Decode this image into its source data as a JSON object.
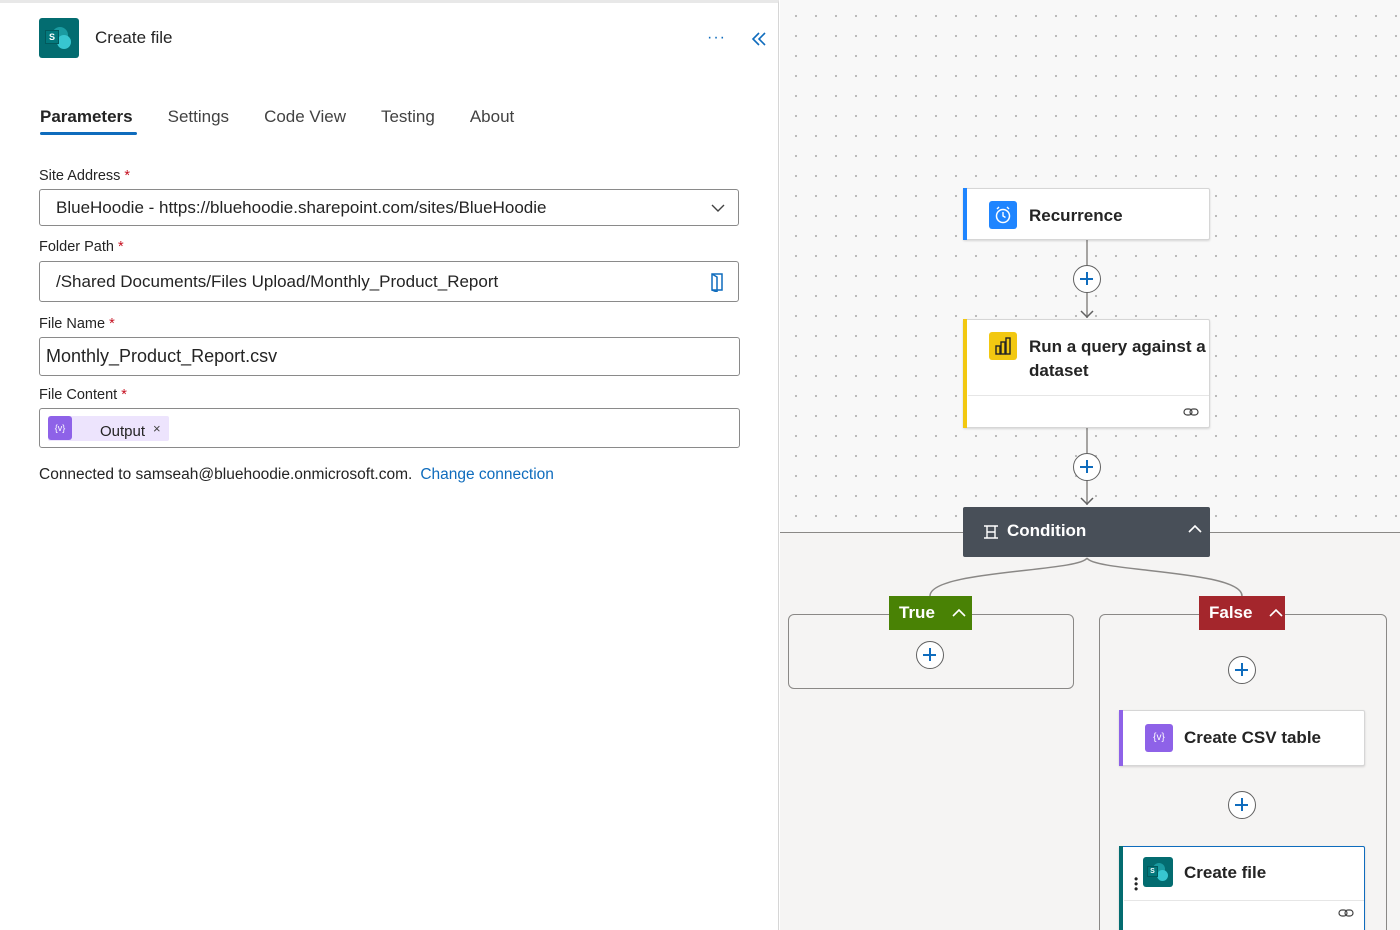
{
  "panel": {
    "title": "Create file",
    "more_label": "···",
    "tabs": [
      {
        "label": "Parameters",
        "active": true
      },
      {
        "label": "Settings",
        "active": false
      },
      {
        "label": "Code View",
        "active": false
      },
      {
        "label": "Testing",
        "active": false
      },
      {
        "label": "About",
        "active": false
      }
    ],
    "fields": {
      "site_address": {
        "label": "Site Address",
        "required": "*",
        "value": "BlueHoodie - https://bluehoodie.sharepoint.com/sites/BlueHoodie"
      },
      "folder_path": {
        "label": "Folder Path",
        "required": "*",
        "value": "/Shared Documents/Files Upload/Monthly_Product_Report"
      },
      "file_name": {
        "label": "File Name",
        "required": "*",
        "value": "Monthly_Product_Report.csv"
      },
      "file_content": {
        "label": "File Content",
        "required": "*",
        "token": "Output",
        "token_icon": "{v}",
        "remove": "×"
      }
    },
    "connection": {
      "text": "Connected to samseah@bluehoodie.onmicrosoft.com.",
      "link": "Change connection"
    }
  },
  "flow": {
    "recurrence": {
      "label": "Recurrence",
      "icon": "alarm-clock-icon",
      "accent": "#1f85ff"
    },
    "query": {
      "label": "Run a query against a dataset",
      "icon": "power-bi-icon",
      "accent": "#f2c811"
    },
    "condition": {
      "label": "Condition",
      "color": "#484f58"
    },
    "true_branch": {
      "label": "True",
      "color": "#498205"
    },
    "false_branch": {
      "label": "False",
      "color": "#a4262c"
    },
    "csv": {
      "label": "Create CSV table",
      "icon": "data-operation-icon",
      "icon_text": "{v}",
      "accent": "#8e62e8"
    },
    "create_file": {
      "label": "Create file",
      "icon": "sharepoint-icon",
      "accent": "#036c70"
    }
  }
}
